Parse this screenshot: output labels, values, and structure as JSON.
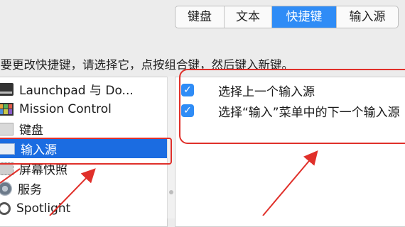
{
  "tabs": [
    {
      "label": "键盘",
      "active": false
    },
    {
      "label": "文本",
      "active": false
    },
    {
      "label": "快捷键",
      "active": true
    },
    {
      "label": "输入源",
      "active": false
    }
  ],
  "instruction": "若要更改快捷键，请选择它，点按组合键，然后键入新键。",
  "categories": [
    {
      "label": "Launchpad 与 Do...",
      "icon": "launchpad-icon"
    },
    {
      "label": "Mission Control",
      "icon": "mission-control-icon"
    },
    {
      "label": "键盘",
      "icon": "keyboard-icon"
    },
    {
      "label": "输入源",
      "icon": "input-source-icon",
      "selected": true
    },
    {
      "label": "屏幕快照",
      "icon": "screenshot-icon"
    },
    {
      "label": "服务",
      "icon": "gear-icon"
    },
    {
      "label": "Spotlight",
      "icon": "spotlight-icon"
    }
  ],
  "shortcuts": [
    {
      "label": "选择上一个输入源",
      "checked": true
    },
    {
      "label": "选择“输入”菜单中的下一个输入源",
      "checked": true
    }
  ],
  "colors": {
    "accent": "#2f8cf6",
    "selection": "#1b6ce1",
    "annotation": "#e0302a"
  }
}
